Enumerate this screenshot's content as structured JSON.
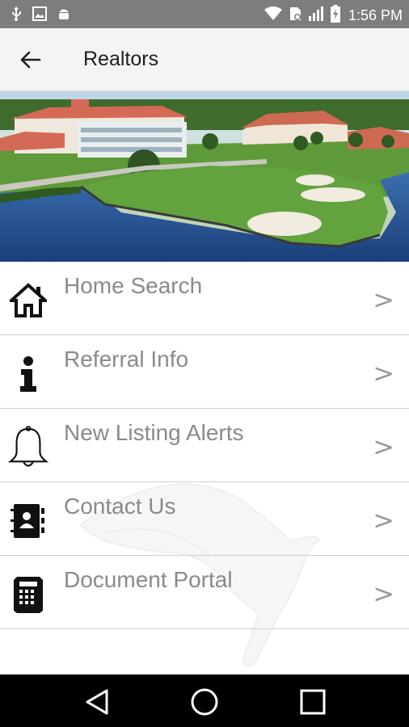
{
  "status_bar": {
    "time": "1:56 PM",
    "icons_left": [
      "usb-icon",
      "image-icon",
      "android-icon"
    ],
    "icons_right": [
      "wifi-icon",
      "sim-icon",
      "signal-icon",
      "battery-charging-icon"
    ]
  },
  "app_bar": {
    "title": "Realtors",
    "back_icon": "arrow-left-icon"
  },
  "menu": {
    "items": [
      {
        "label": "Home Search",
        "icon": "house-icon",
        "chevron": ">"
      },
      {
        "label": "Referral Info",
        "icon": "info-icon",
        "chevron": ">"
      },
      {
        "label": "New Listing Alerts",
        "icon": "bell-icon",
        "chevron": ">"
      },
      {
        "label": "Contact Us",
        "icon": "contact-book-icon",
        "chevron": ">"
      },
      {
        "label": "Document Portal",
        "icon": "document-icon",
        "chevron": ">"
      }
    ]
  },
  "nav_bar": {
    "buttons": [
      "back-triangle-icon",
      "home-circle-icon",
      "recents-square-icon"
    ]
  },
  "colors": {
    "status_bar": "#7d7d7d",
    "app_bar": "#f4f4f4",
    "label_gray": "#8a8a8a",
    "divider": "#cfcfcf"
  }
}
